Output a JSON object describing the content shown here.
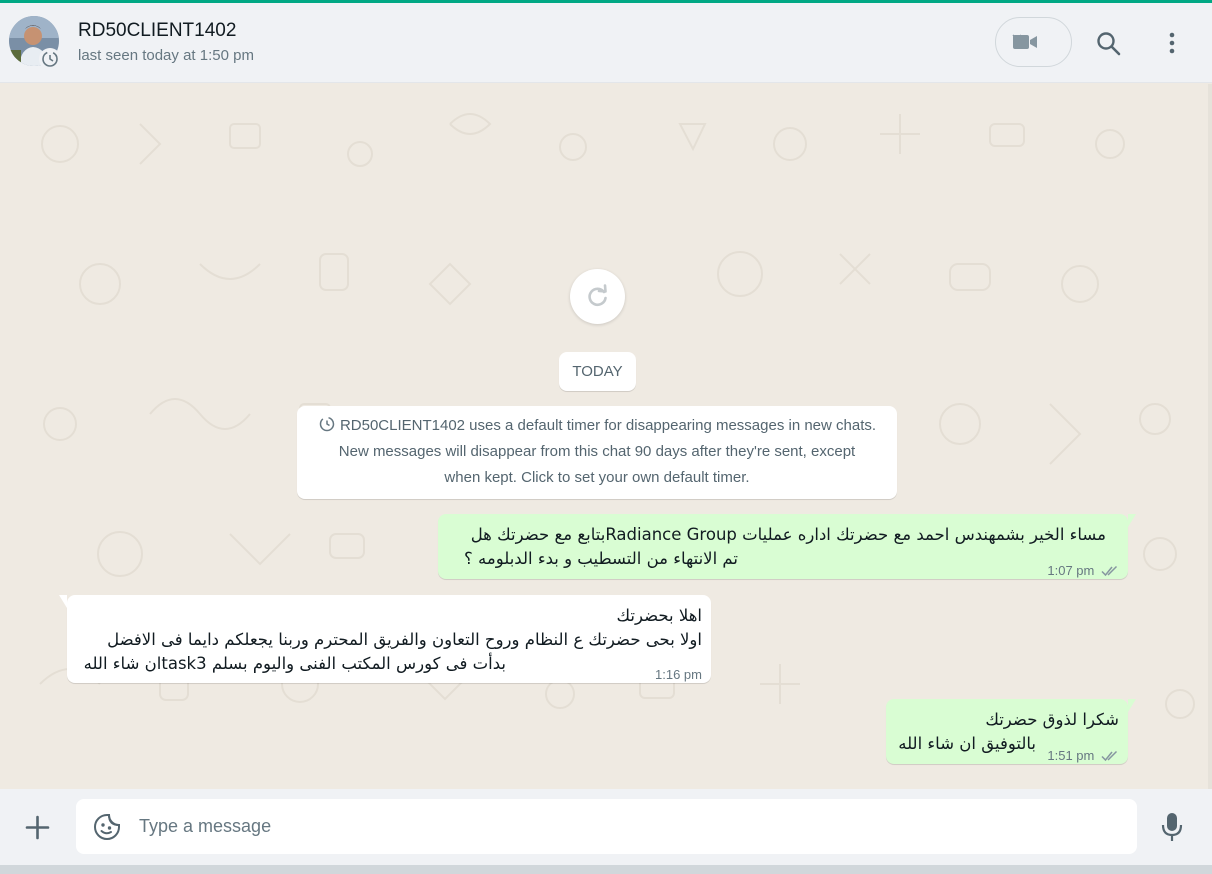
{
  "header": {
    "contact_name": "RD50CLIENT1402",
    "status": "last seen today at 1:50 pm",
    "icons": [
      "video-camera-icon",
      "chevron-down-icon",
      "search-icon",
      "menu-icon"
    ]
  },
  "chat": {
    "date_chip": "TODAY",
    "system_note": {
      "line1": "RD50CLIENT1402 uses a default timer for disappearing messages in new chats.",
      "line2": "New messages will disappear from this chat 90 days after they're sent, except",
      "line3": "when kept. Click to set your own default timer."
    },
    "messages": [
      {
        "direction": "outgoing",
        "lines": [
          "مساء الخير بشمهندس احمد مع  حضرتك اداره عمليات Radiance Groupبتابع مع حضرتك هل",
          "تم الانتهاء من التسطيب و بدء الدبلومه ؟"
        ],
        "time": "1:07 pm",
        "status": "read"
      },
      {
        "direction": "incoming",
        "lines": [
          "اهلا بحضرتك",
          "اولا بحى حضرتك ع النظام وروح التعاون والفريق المحترم وربنا يجعلكم دايما فى الافضل",
          "بدأت فى كورس المكتب الفنى واليوم بسلم task3ان شاء الله"
        ],
        "time": "1:16 pm"
      },
      {
        "direction": "outgoing",
        "lines": [
          "شكرا لذوق حضرتك",
          "بالتوفيق ان شاء الله"
        ],
        "time": "1:51 pm",
        "status": "read"
      }
    ]
  },
  "composer": {
    "placeholder": "Type a message"
  },
  "colors": {
    "accent": "#00a884",
    "outgoing_bubble": "#d9fdd3",
    "incoming_bubble": "#ffffff",
    "chat_background": "#efeae2",
    "read_ticks": "#8696a0"
  }
}
